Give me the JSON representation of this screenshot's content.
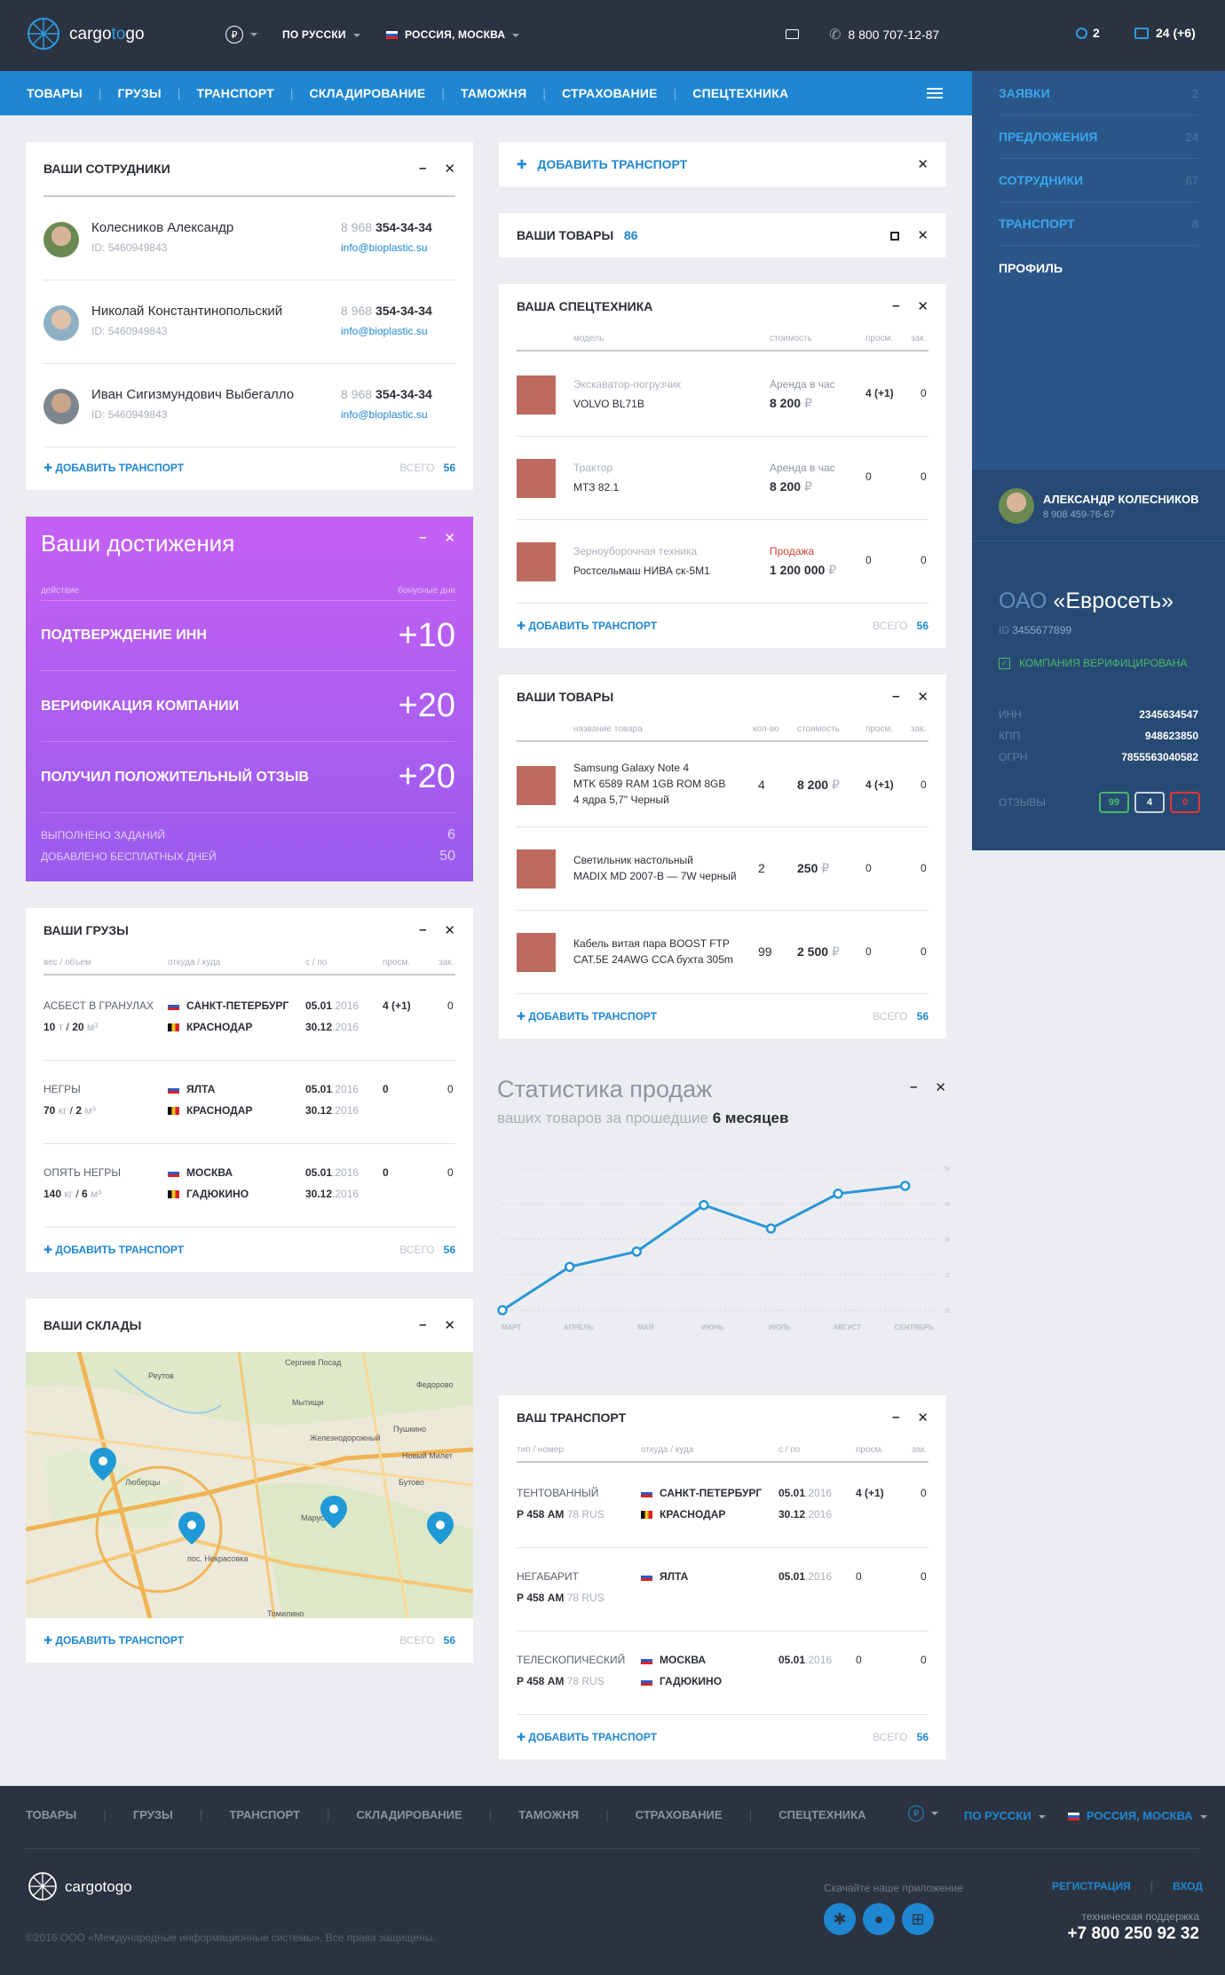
{
  "header": {
    "logo_a": "cargo",
    "logo_b": "to",
    "logo_c": "go",
    "currency": "₽",
    "language": "ПО РУССКИ",
    "location": "РОССИЯ, МОСКВА",
    "phone": "8 800 707-12-87",
    "search_count": "2",
    "messages": "24 (+6)"
  },
  "nav": [
    "ТОВАРЫ",
    "ГРУЗЫ",
    "ТРАНСПОРТ",
    "СКЛАДИРОВАНИЕ",
    "ТАМОЖНЯ",
    "СТРАХОВАНИЕ",
    "СПЕЦТЕХНИКА"
  ],
  "sidebar": {
    "items": [
      {
        "label": "ЗАЯВКИ",
        "count": "2"
      },
      {
        "label": "ПРЕДЛОЖЕНИЯ",
        "count": "24"
      },
      {
        "label": "СОТРУДНИКИ",
        "count": "67"
      },
      {
        "label": "ТРАНСПОРТ",
        "count": "8"
      },
      {
        "label": "ПРОФИЛЬ",
        "count": ""
      }
    ],
    "user": {
      "name": "АЛЕКСАНДР КОЛЕСНИКОВ",
      "phone": "8 908 459-76-67"
    },
    "company": {
      "prefix": "ОАО",
      "name": "«Евросеть»",
      "id_label": "ID",
      "id": "3455677899",
      "verified": "КОМПАНИЯ ВЕРИФИЦИРОВАНА",
      "inn_label": "ИНН",
      "inn": "2345634547",
      "kpp_label": "КПП",
      "kpp": "948623850",
      "ogrn_label": "ОГРН",
      "ogrn": "7855563040582",
      "reviews_label": "ОТЗЫВЫ",
      "reviews": [
        "99",
        "4",
        "0"
      ]
    }
  },
  "employees": {
    "title": "ВАШИ СОТРУДНИКИ",
    "items": [
      {
        "name": "Колесников Александр",
        "id": "5460949843",
        "phone_a": "8 968",
        "phone_b": "354-34-34",
        "email": "info@bioplastic.su"
      },
      {
        "name": "Николай Константинопольский",
        "id": "5460949843",
        "phone_a": "8 968",
        "phone_b": "354-34-34",
        "email": "info@bioplastic.su"
      },
      {
        "name": "Иван Сигизмундович Выбегалло",
        "id": "5460949843",
        "phone_a": "8 968",
        "phone_b": "354-34-34",
        "email": "info@bioplastic.su"
      }
    ],
    "id_label": "ID:",
    "add": "ДОБАВИТЬ ТРАНСПОРТ",
    "total_label": "ВСЕГО",
    "total": "56"
  },
  "achievements": {
    "title": "Ваши достижения",
    "col_a": "действие",
    "col_b": "бонусные дни",
    "items": [
      {
        "label": "ПОДТВЕРЖДЕНИЕ ИНН",
        "pts": "+10"
      },
      {
        "label": "ВЕРИФИКАЦИЯ КОМПАНИИ",
        "pts": "+20"
      },
      {
        "label": "ПОЛУЧИЛ ПОЛОЖИТЕЛЬНЫЙ ОТЗЫВ",
        "pts": "+20"
      }
    ],
    "done_label": "ВЫПОЛНЕНО ЗАДАНИЙ",
    "done": "6",
    "days_label": "ДОБАВЛЕНО БЕСПЛАТНЫХ ДНЕЙ",
    "days": "50"
  },
  "cargo": {
    "title": "ВАШИ ГРУЗЫ",
    "cols": [
      "вес / объем",
      "откуда / куда",
      "с / по",
      "просм.",
      "зак."
    ],
    "items": [
      {
        "type": "АСБЕСТ В ГРАНУЛАХ",
        "w": "10",
        "wu": "т",
        "v": "20",
        "vu": "м³",
        "from": "САНКТ-ПЕТЕРБУРГ",
        "to": "КРАСНОДАР",
        "d1a": "05.01",
        "d1b": ".2016",
        "d2a": "30.12",
        "d2b": ".2016",
        "views": "4 (+1)",
        "orders": "0"
      },
      {
        "type": "НЕГРЫ",
        "w": "70",
        "wu": "кг",
        "v": "2",
        "vu": "м³",
        "from": "ЯЛТА",
        "to": "КРАСНОДАР",
        "d1a": "05.01",
        "d1b": ".2016",
        "d2a": "30.12",
        "d2b": ".2016",
        "views": "0",
        "orders": "0"
      },
      {
        "type": "ОПЯТЬ НЕГРЫ",
        "w": "140",
        "wu": "кг",
        "v": "6",
        "vu": "м³",
        "from": "МОСКВА",
        "to": "ГАДЮКИНО",
        "d1a": "05.01",
        "d1b": ".2016",
        "d2a": "30.12",
        "d2b": ".2016",
        "views": "0",
        "orders": "0"
      }
    ],
    "add": "ДОБАВИТЬ ТРАНСПОРТ",
    "total_label": "ВСЕГО",
    "total": "56"
  },
  "warehouses": {
    "title": "ВАШИ СКЛАДЫ",
    "map_labels": [
      "Реутов",
      "Сергиев Посад",
      "Мытищи",
      "Пушкино",
      "Люберцы",
      "Бутово",
      "Новый Милет",
      "Марусино",
      "пос. Некрасовка",
      "Томилино",
      "Федорово",
      "Железнодорожный"
    ],
    "add": "ДОБАВИТЬ ТРАНСПОРТ",
    "total_label": "ВСЕГО",
    "total": "56"
  },
  "add_transport": {
    "label": "ДОБАВИТЬ ТРАНСПОРТ"
  },
  "goods_small": {
    "title": "ВАШИ ТОВАРЫ",
    "count": "86"
  },
  "special": {
    "title": "ВАША СПЕЦТЕХНИКА",
    "cols": [
      "модель",
      "стоимость",
      "просм.",
      "зак."
    ],
    "items": [
      {
        "kind": "Экскаватор-погрузчик",
        "name": "VOLVO BL71B",
        "price_label": "Аренда в час",
        "price": "8 200",
        "views": "4 (+1)",
        "orders": "0"
      },
      {
        "kind": "Трактор",
        "name": "МТЗ 82.1",
        "price_label": "Аренда в час",
        "price": "8 200",
        "views": "0",
        "orders": "0"
      },
      {
        "kind": "Зерноуборочная техника",
        "name": "Ростсельмаш НИВА ск-5М1",
        "price_label": "Продажа",
        "price": "1 200 000",
        "views": "0",
        "orders": "0"
      }
    ],
    "currency": "₽",
    "add": "ДОБАВИТЬ ТРАНСПОРТ",
    "total_label": "ВСЕГО",
    "total": "56"
  },
  "goods": {
    "title": "ВАШИ ТОВАРЫ",
    "cols": [
      "название товара",
      "кол-во",
      "стоимость",
      "просм.",
      "зак."
    ],
    "items": [
      {
        "l1": "Samsung Galaxy Note 4",
        "l2": "MTK 6589 RAM 1GB ROM 8GB",
        "l3": "4 ядра 5,7\" Черный",
        "qty": "4",
        "price": "8 200",
        "views": "4 (+1)",
        "orders": "0"
      },
      {
        "l1": "Светильник настольный",
        "l2": "MADIX MD 2007-B — 7W черный",
        "l3": "",
        "qty": "2",
        "price": "250",
        "views": "0",
        "orders": "0"
      },
      {
        "l1": "Кабель витая пара BOOST FTP",
        "l2": "CAT.5E 24AWG CCA бухта 305m",
        "l3": "",
        "qty": "99",
        "price": "2 500",
        "views": "0",
        "orders": "0"
      }
    ],
    "currency": "₽",
    "add": "ДОБАВИТЬ ТРАНСПОРТ",
    "total_label": "ВСЕГО",
    "total": "56"
  },
  "stats": {
    "title": "Статистика продаж",
    "sub_a": "ваших товаров за прошедшие",
    "sub_b": "6 месяцев"
  },
  "chart_data": {
    "type": "line",
    "categories": [
      "МАРТ",
      "АПРЕЛЬ",
      "МАЙ",
      "ИЮНЬ",
      "ИЮЛЬ",
      "АВГУСТ",
      "СЕНТЯБРЬ"
    ],
    "x": [
      0,
      1,
      2,
      3,
      4,
      5,
      6,
      6.4
    ],
    "values": [
      100,
      222,
      265,
      396,
      330,
      428,
      450
    ],
    "ylim": [
      100,
      500
    ],
    "yticks": [
      "500",
      "400",
      "300",
      "200",
      "100"
    ],
    "color": "#2a97d6",
    "grid": true
  },
  "transport": {
    "title": "ВАШ ТРАНСПОРТ",
    "cols": [
      "тип / номер",
      "откуда / куда",
      "с / по",
      "просм.",
      "зак."
    ],
    "items": [
      {
        "type": "ТЕНТОВАННЫЙ",
        "plate": "Р 458 АМ",
        "region": "78 RUS",
        "from": "САНКТ-ПЕТЕРБУРГ",
        "to": "КРАСНОДАР",
        "d1a": "05.01",
        "d1b": ".2016",
        "d2a": "30.12",
        "d2b": ".2016",
        "views": "4 (+1)",
        "orders": "0"
      },
      {
        "type": "НЕГАБАРИТ",
        "plate": "Р 458 АМ",
        "region": "78 RUS",
        "from": "ЯЛТА",
        "to": "",
        "d1a": "05.01",
        "d1b": ".2016",
        "d2a": "",
        "d2b": "",
        "views": "0",
        "orders": "0"
      },
      {
        "type": "ТЕЛЕСКОПИЧЕСКИЙ",
        "plate": "Р 458 АМ",
        "region": "78 RUS",
        "from": "МОСКВА",
        "to": "ГАДЮКИНО",
        "d1a": "05.01",
        "d1b": ".2016",
        "d2a": "",
        "d2b": "",
        "views": "0",
        "orders": "0"
      }
    ],
    "add": "ДОБАВИТЬ ТРАНСПОРТ",
    "total_label": "ВСЕГО",
    "total": "56"
  },
  "footer": {
    "nav": [
      "ТОВАРЫ",
      "ГРУЗЫ",
      "ТРАНСПОРТ",
      "СКЛАДИРОВАНИЕ",
      "ТАМОЖНЯ",
      "СТРАХОВАНИЕ",
      "СПЕЦТЕХНИКА"
    ],
    "currency": "₽",
    "language": "ПО РУССКИ",
    "location": "РОССИЯ, МОСКВА",
    "app_label": "Скачайте наше приложение",
    "register": "РЕГИСТРАЦИЯ",
    "login": "ВХОД",
    "support_label": "техническая поддержка",
    "support_phone": "+7 800 250 92 32",
    "copyright": "©2016 ООО «Международные информационные системы». Все права защищены."
  }
}
